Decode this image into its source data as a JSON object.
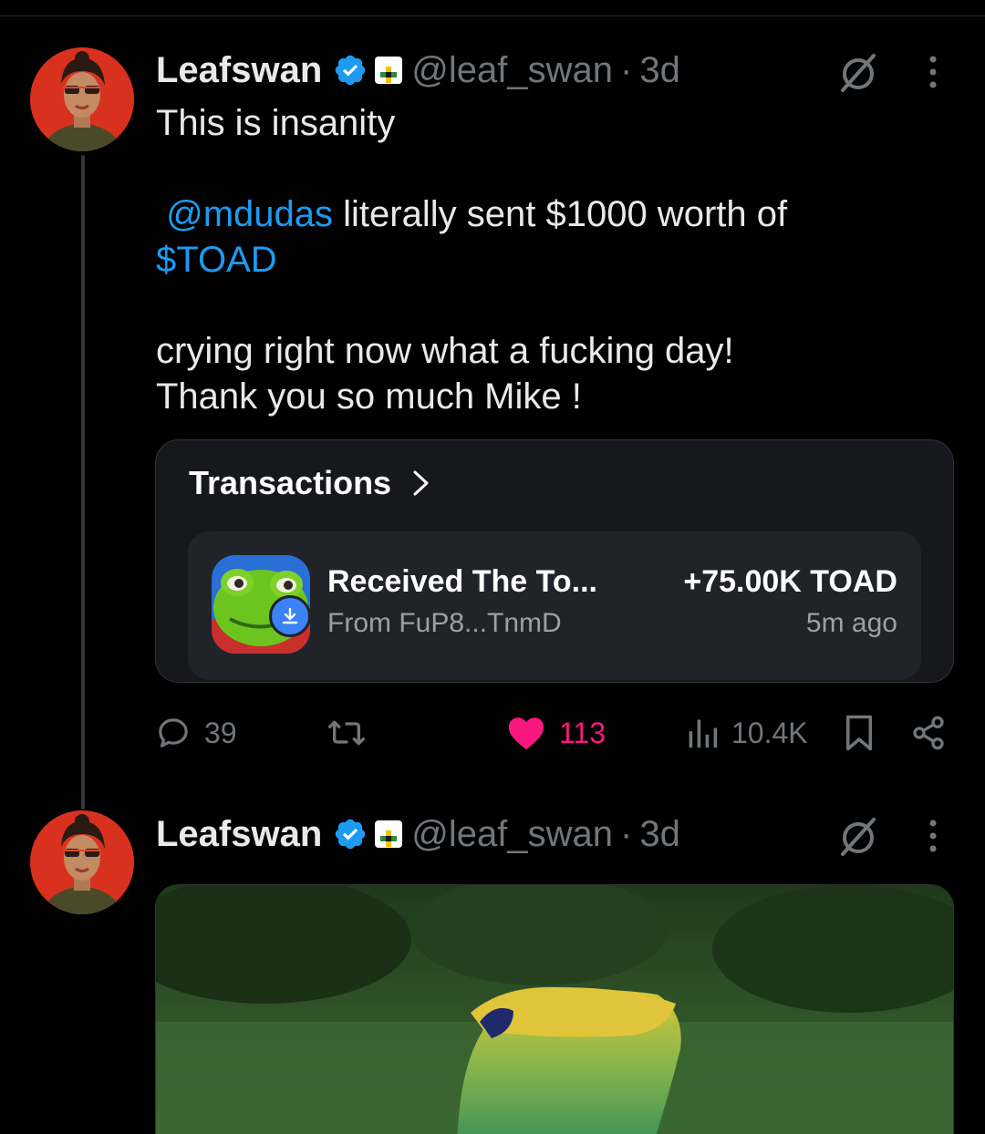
{
  "tweet1": {
    "author": "Leafswan",
    "handle": "@leaf_swan",
    "separator": "·",
    "time": "3d",
    "text_line1": "This is insanity",
    "mention": "@mdudas",
    "text_line2_rest": " literally sent $1000 worth of",
    "cashtag": "$TOAD",
    "text_line4": "crying right now what a fucking day!",
    "text_line5": "Thank you so much Mike !",
    "card": {
      "title": "Transactions",
      "tx_name": "Received The To...",
      "tx_from": "From FuP8...TnmD",
      "tx_amount": "+75.00K TOAD",
      "tx_time": "5m ago"
    },
    "actions": {
      "replies": "39",
      "reposts": "",
      "likes": "113",
      "views": "10.4K"
    }
  },
  "tweet2": {
    "author": "Leafswan",
    "handle": "@leaf_swan",
    "separator": "·",
    "time": "3d"
  },
  "colors": {
    "background": "#000000",
    "text": "#e7e9ea",
    "muted": "#71767b",
    "link": "#1d9bf0",
    "like": "#f91880",
    "verified": "#1d9bf0"
  },
  "icons": [
    "verified-badge-icon",
    "affiliate-badge-icon",
    "grok-icon",
    "more-icon",
    "chevron-right-icon",
    "download-icon",
    "reply-icon",
    "retweet-icon",
    "heart-icon",
    "views-icon",
    "bookmark-icon",
    "share-icon"
  ]
}
